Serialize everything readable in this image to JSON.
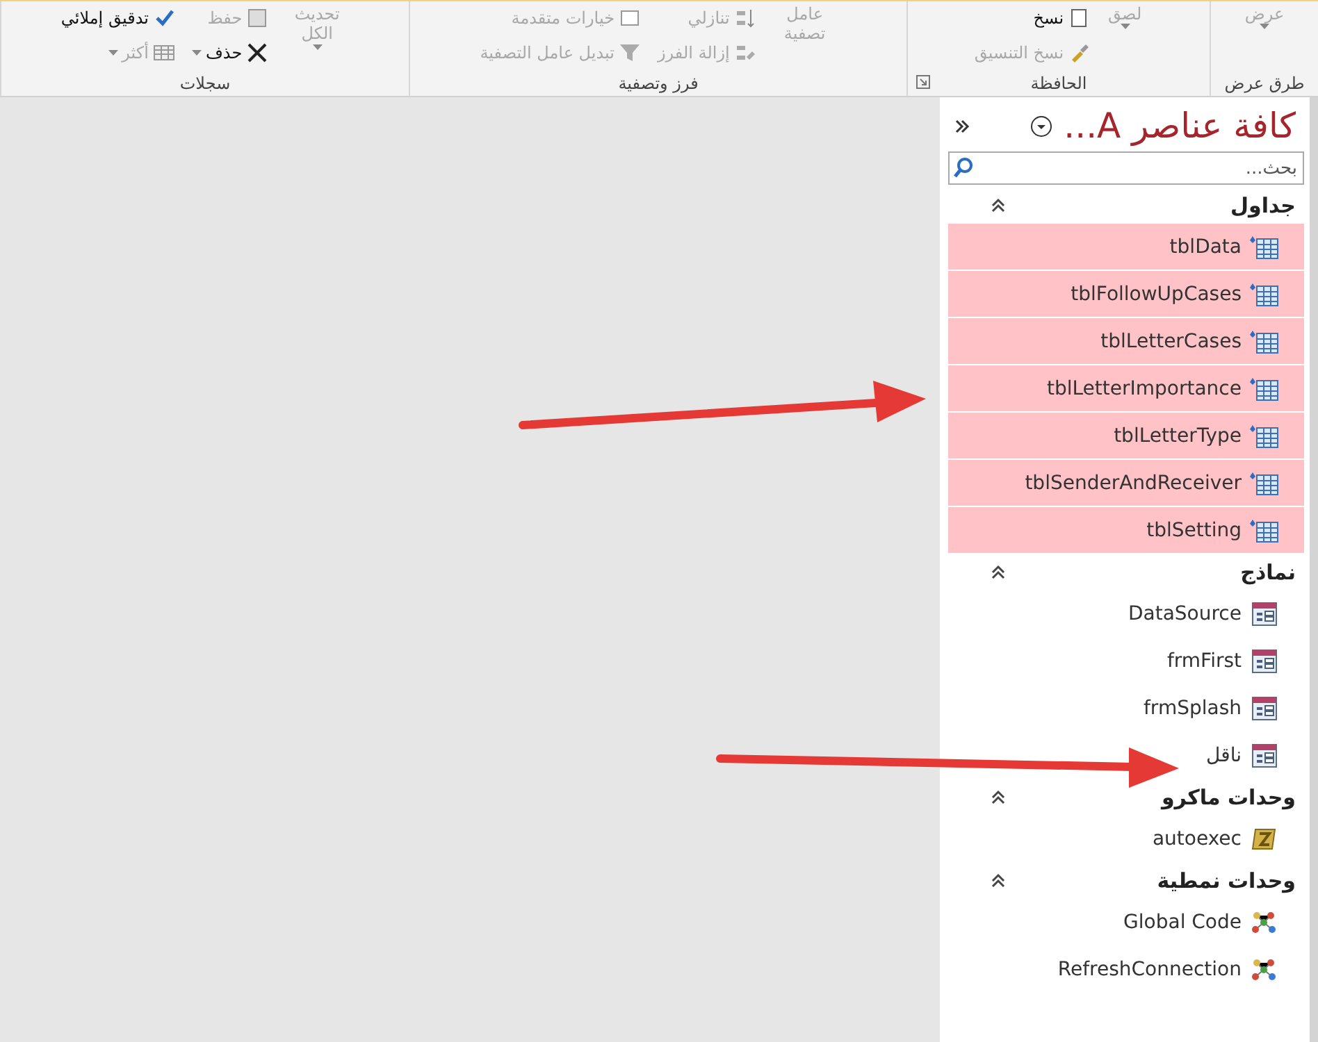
{
  "ribbon": {
    "groups": [
      {
        "label": "طرق عرض",
        "launcher": false,
        "columns": [
          {
            "kind": "large",
            "buttons": [
              {
                "label": "عرض",
                "disabled": true,
                "dropdown": true
              }
            ]
          }
        ]
      },
      {
        "label": "الحافظة",
        "launcher": true,
        "columns": [
          {
            "kind": "large",
            "buttons": [
              {
                "label": "لصق",
                "disabled": true,
                "dropdown": true
              }
            ]
          },
          {
            "kind": "stack",
            "buttons": [
              {
                "label": "نسخ",
                "disabled": false,
                "dropdown": false
              },
              {
                "label": "نسخ التنسيق",
                "disabled": true,
                "dropdown": false
              }
            ]
          }
        ]
      },
      {
        "label": "فرز وتصفية",
        "launcher": false,
        "columns": [
          {
            "kind": "large",
            "buttons": [
              {
                "label": "عامل تصفية",
                "disabled": true,
                "dropdown": false
              }
            ]
          },
          {
            "kind": "stack",
            "buttons": [
              {
                "label": "تنازلي",
                "disabled": true,
                "dropdown": false
              },
              {
                "label": "إزالة الفرز",
                "disabled": true,
                "dropdown": false
              }
            ]
          },
          {
            "kind": "stack",
            "buttons": [
              {
                "label": "خيارات متقدمة",
                "disabled": true,
                "dropdown": false
              },
              {
                "label": "تبديل عامل التصفية",
                "disabled": true,
                "dropdown": false
              }
            ]
          }
        ]
      },
      {
        "label": "سجلات",
        "launcher": false,
        "columns": [
          {
            "kind": "large",
            "buttons": [
              {
                "label": "تحديث الكل",
                "disabled": true,
                "dropdown": true
              }
            ]
          },
          {
            "kind": "stack",
            "buttons": [
              {
                "label": "حفظ",
                "disabled": true,
                "dropdown": false
              },
              {
                "label": "حذف",
                "disabled": false,
                "dropdown": true
              }
            ]
          },
          {
            "kind": "stack",
            "buttons": [
              {
                "label": "تدقيق إملائي",
                "disabled": false,
                "dropdown": false
              },
              {
                "label": "أكثر",
                "disabled": true,
                "dropdown": true
              }
            ]
          }
        ]
      }
    ]
  },
  "nav_pane": {
    "title": "كافة عناصر A...",
    "search": {
      "placeholder": "بحث..."
    },
    "groups": [
      {
        "label": "جداول",
        "expanded": true,
        "items": [
          {
            "name": "tblData",
            "kind": "table",
            "selected": true
          },
          {
            "name": "tblFollowUpCases",
            "kind": "table",
            "selected": true
          },
          {
            "name": "tblLetterCases",
            "kind": "table",
            "selected": true
          },
          {
            "name": "tblLetterImportance",
            "kind": "table",
            "selected": true
          },
          {
            "name": "tblLetterType",
            "kind": "table",
            "selected": true
          },
          {
            "name": "tblSenderAndReceiver",
            "kind": "table",
            "selected": true
          },
          {
            "name": "tblSetting",
            "kind": "table",
            "selected": true
          }
        ]
      },
      {
        "label": "نماذج",
        "expanded": true,
        "items": [
          {
            "name": "DataSource",
            "kind": "form",
            "selected": false
          },
          {
            "name": "frmFirst",
            "kind": "form",
            "selected": false
          },
          {
            "name": "frmSplash",
            "kind": "form",
            "selected": false
          },
          {
            "name": "ناقل",
            "kind": "form",
            "selected": false
          }
        ]
      },
      {
        "label": "وحدات ماكرو",
        "expanded": true,
        "items": [
          {
            "name": "autoexec",
            "kind": "macro",
            "selected": false
          }
        ]
      },
      {
        "label": "وحدات نمطية",
        "expanded": true,
        "items": [
          {
            "name": "Global Code",
            "kind": "module",
            "selected": false
          },
          {
            "name": "RefreshConnection",
            "kind": "module",
            "selected": false
          }
        ]
      }
    ]
  }
}
